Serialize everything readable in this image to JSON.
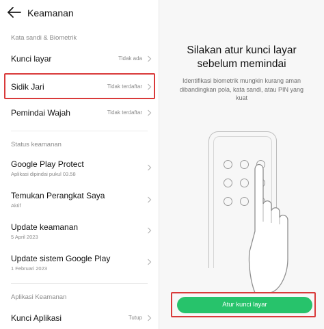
{
  "header": {
    "title": "Keamanan",
    "back_icon": "arrow-left-icon"
  },
  "sections": {
    "password_biometric": "Kata sandi & Biometrik",
    "security_status": "Status keamanan",
    "security_apps": "Aplikasi Keamanan"
  },
  "rows": {
    "screen_lock": {
      "title": "Kunci layar",
      "value": "Tidak ada"
    },
    "fingerprint": {
      "title": "Sidik Jari",
      "value": "Tidak terdaftar"
    },
    "face_scan": {
      "title": "Pemindai Wajah",
      "value": "Tidak terdaftar"
    },
    "play_protect": {
      "title": "Google Play Protect",
      "sub": "Aplikasi dipindai pukul 03.58"
    },
    "find_device": {
      "title": "Temukan Perangkat Saya",
      "sub": "Aktif"
    },
    "security_update": {
      "title": "Update keamanan",
      "sub": "5 April 2023"
    },
    "play_system_update": {
      "title": "Update sistem Google Play",
      "sub": "1 Februari 2023"
    },
    "app_lock": {
      "title": "Kunci Aplikasi",
      "value": "Tutup"
    }
  },
  "right_panel": {
    "heading_line1": "Silakan atur kunci layar",
    "heading_line2": "sebelum memindai",
    "description": "Identifikasi biometrik mungkin kurang aman dibandingkan pola, kata sandi, atau PIN yang kuat",
    "button_label": "Atur kunci layar",
    "illustration_icon": "phone-pattern-unlock-icon"
  },
  "colors": {
    "accent_green": "#27c36b",
    "highlight_red": "#d93a3a"
  }
}
